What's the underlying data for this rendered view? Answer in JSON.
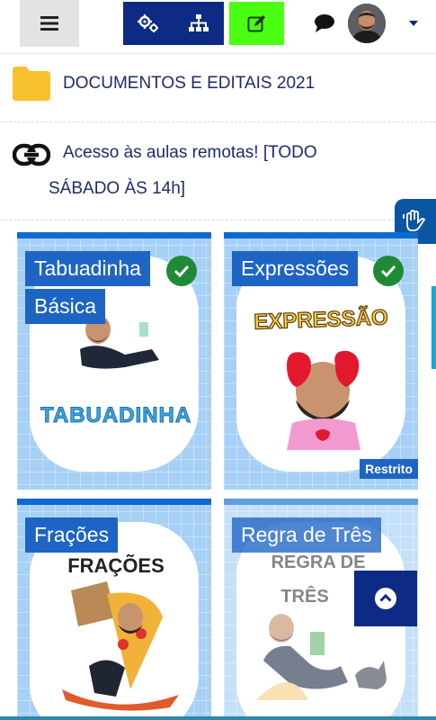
{
  "navbar": {
    "menu_icon": "hamburger-icon",
    "settings_icon": "gears-icon",
    "structure_icon": "sitemap-icon",
    "edit_icon": "edit-icon",
    "chat_icon": "chat-icon",
    "avatar": "user-avatar",
    "dropdown_icon": "caret-down-icon",
    "colors": {
      "group": "#0d2a84",
      "edit": "#4bff12"
    }
  },
  "sections": {
    "folder": {
      "icon": "folder-icon",
      "label": "DOCUMENTOS E EDITAIS 2021"
    },
    "link": {
      "icon": "link-icon",
      "label_line1": "Acesso às aulas remotas! [TODO",
      "label_line2": "SÁBADO ÀS 14h]"
    }
  },
  "accessibility": {
    "icon": "hand-sign-language-icon"
  },
  "cards": [
    {
      "label_line1": "Tabuadinha",
      "label_line2": "Básica",
      "art_text": "TABUADINHA",
      "completed": true,
      "restricted": false
    },
    {
      "label_line1": "Expressões",
      "art_text": "EXPRESSÃO",
      "completed": true,
      "restricted": true,
      "restricted_label": "Restrito"
    },
    {
      "label_line1": "Frações",
      "art_text": "FRAÇÕES",
      "completed": false,
      "restricted": false
    },
    {
      "label_line1": "Regra de Três",
      "art_text_line1": "REGRA DE",
      "art_text_line2": "TRÊS",
      "completed": false,
      "restricted": false
    }
  ],
  "back_to_top": {
    "icon": "chevron-up-icon"
  },
  "colors": {
    "text": "#1f2a6b",
    "card_label": "#1e64c4",
    "check": "#1f8a36"
  }
}
